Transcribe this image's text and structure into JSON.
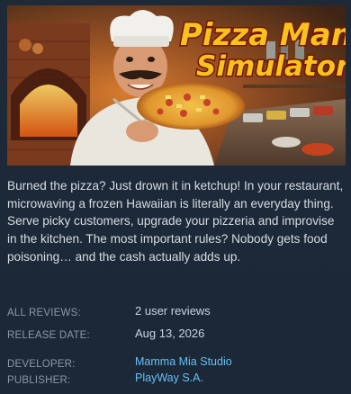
{
  "game": {
    "title_line1": "Pizza Man",
    "title_line2": "Simulator",
    "description": "Burned the pizza? Just drown it in ketchup! In your restaurant, microwaving a frozen Hawaiian is literally an everyday thing. Serve picky customers, upgrade your pizzeria and improvise in the kitchen. The most important rules? Nobody gets food poisoning… and the cash actually adds up."
  },
  "info": {
    "all_reviews_label": "ALL REVIEWS:",
    "all_reviews_value": "2 user reviews",
    "release_date_label": "RELEASE DATE:",
    "release_date_value": "Aug 13, 2026",
    "developer_label": "DEVELOPER:",
    "developer_value": "Mamma Mia Studio",
    "publisher_label": "PUBLISHER:",
    "publisher_value": "PlayWay S.A."
  },
  "colors": {
    "background": "#1b2838",
    "link": "#66c0f4",
    "label": "#8b97a3",
    "title_fill": "#f6c21c",
    "title_outline": "#7a1408"
  }
}
